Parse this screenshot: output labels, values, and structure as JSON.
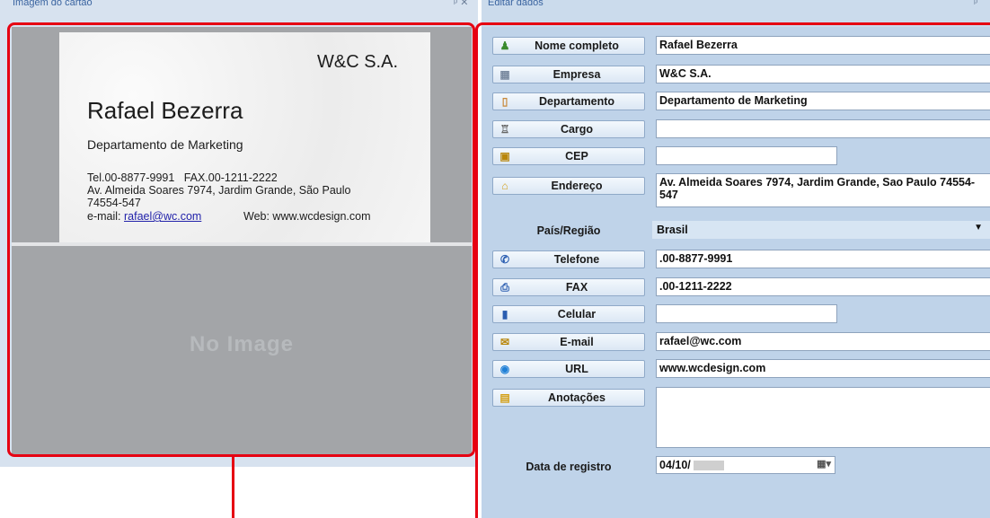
{
  "left_pane": {
    "title": "Imagem do cartão",
    "controls": "ᵖ ✕",
    "card": {
      "company": "W&C S.A.",
      "name": "Rafael Bezerra",
      "department": "Departamento de Marketing",
      "tel_fax": "Tel.00-8877-9991   FAX.00-1211-2222",
      "address": "Av. Almeida Soares 7974, Jardim Grande, São Paulo",
      "zip": "74554-547",
      "email_prefix": "e-mail: ",
      "email_link": "rafael@wc.com",
      "web": "Web: www.wcdesign.com"
    },
    "no_image_text": "No Image"
  },
  "right_pane": {
    "title": "Editar dados",
    "controls": "ᵖ",
    "fields": {
      "nome": {
        "label": "Nome completo",
        "icon": "person-icon",
        "value": "Rafael Bezerra"
      },
      "empresa": {
        "label": "Empresa",
        "icon": "building-icon",
        "value": "W&C S.A."
      },
      "depto": {
        "label": "Departamento",
        "icon": "door-icon",
        "value": "Departamento de Marketing"
      },
      "cargo": {
        "label": "Cargo",
        "icon": "chair-icon",
        "value": ""
      },
      "cep": {
        "label": "CEP",
        "icon": "postal-icon",
        "value": ""
      },
      "endereco": {
        "label": "Endereço",
        "icon": "house-icon",
        "value": "Av. Almeida Soares 7974, Jardim Grande, Sao Paulo 74554-547"
      },
      "pais": {
        "label": "País/Região",
        "value": "Brasil"
      },
      "telefone": {
        "label": "Telefone",
        "icon": "phone-icon",
        "value": ".00-8877-9991"
      },
      "fax": {
        "label": "FAX",
        "icon": "fax-icon",
        "value": ".00-1211-2222"
      },
      "celular": {
        "label": "Celular",
        "icon": "mobile-icon",
        "value": ""
      },
      "email": {
        "label": "E-mail",
        "icon": "envelope-icon",
        "value": "rafael@wc.com"
      },
      "url": {
        "label": "URL",
        "icon": "globe-icon",
        "value": "www.wcdesign.com"
      },
      "anotacoes": {
        "label": "Anotações",
        "icon": "note-icon",
        "value": ""
      },
      "data": {
        "label": "Data de registro",
        "icon": "calendar-icon",
        "value": "04/10/"
      }
    }
  },
  "colors": {
    "highlight_red": "#e60012",
    "pane_background": "#bfd3e9",
    "image_placeholder": "#a3a5a8"
  }
}
